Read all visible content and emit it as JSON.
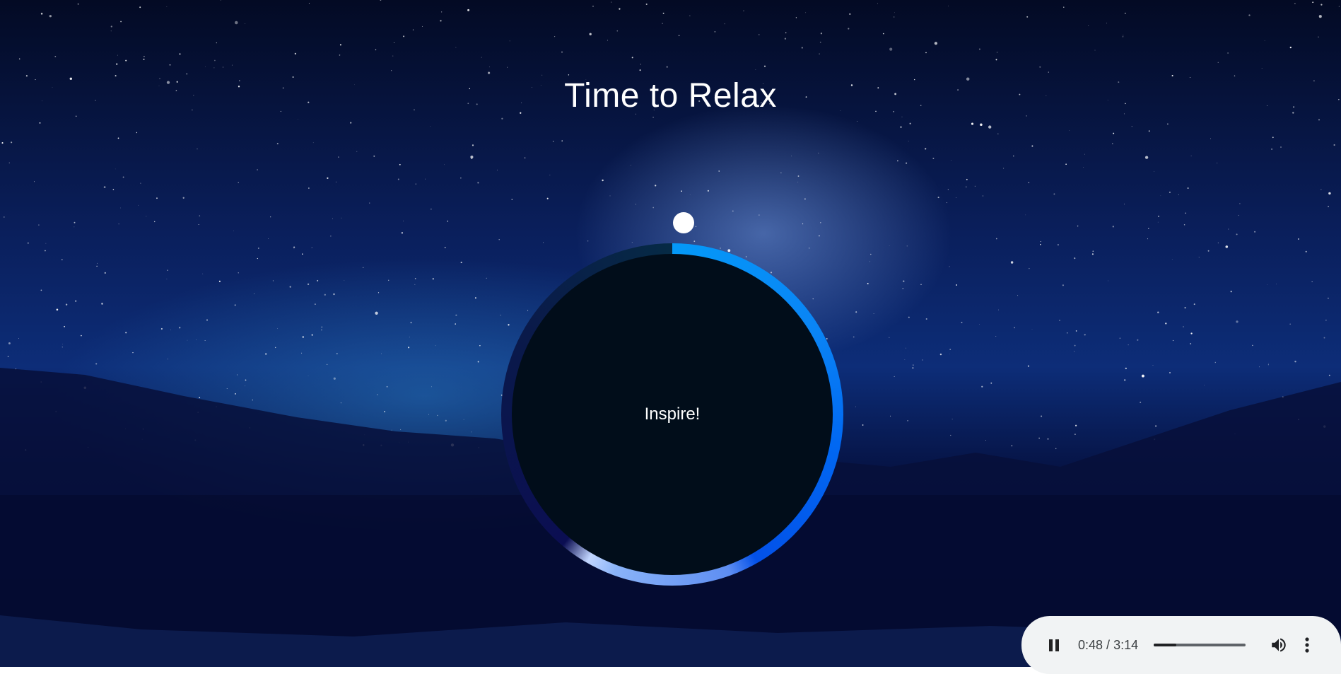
{
  "page": {
    "title": "Time to Relax"
  },
  "breath": {
    "instruction": "Inspire!"
  },
  "audio_player": {
    "current_time": "0:48",
    "separator": " / ",
    "duration": "3:14",
    "progress_fraction": 0.247,
    "icons": {
      "play_pause": "pause-icon",
      "volume": "volume-icon",
      "more": "more-vert-icon"
    }
  },
  "colors": {
    "ring_accent": "#0168f2",
    "inner_circle": "#010d1a",
    "pointer": "#ffffff",
    "player_background": "#f1f3f4"
  }
}
